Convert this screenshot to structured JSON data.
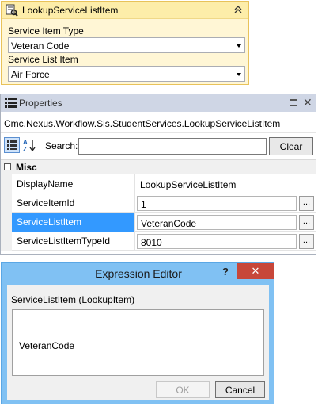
{
  "activity": {
    "title": "LookupServiceListItem",
    "icon": "lookup-activity-icon",
    "collapse_icon": "double-chevron-up-icon",
    "service_item_type_label": "Service Item Type",
    "service_item_type_value": "Veteran Code",
    "service_list_item_label": "Service List Item",
    "service_list_item_value": "Air Force",
    "colors": {
      "border": "#e8c25a",
      "background": "#fff6d5",
      "header": "#fdeda9"
    }
  },
  "properties": {
    "title": "Properties",
    "type_name": "Cmc.Nexus.Workflow.Sis.StudentServices.LookupServiceListItem",
    "search_label": "Search:",
    "search_value": "",
    "clear_label": "Clear",
    "category": "Misc",
    "rows": [
      {
        "name": "DisplayName",
        "value": "LookupServiceListItem"
      },
      {
        "name": "ServiceItemId",
        "value": "1"
      },
      {
        "name": "ServiceListItem",
        "value": "VeteranCode"
      },
      {
        "name": "ServiceListItemTypeId",
        "value": "8010"
      }
    ],
    "ellipsis": "...",
    "selected_row": "ServiceListItem",
    "colors": {
      "titlebar": "#cfd6e5",
      "selection": "#3399ff"
    }
  },
  "dialog": {
    "title": "Expression Editor",
    "help": "?",
    "close": "✕",
    "label": "ServiceListItem (LookupItem)",
    "expression": "VeteranCode",
    "ok_label": "OK",
    "cancel_label": "Cancel",
    "colors": {
      "frame": "#80c1f3",
      "close": "#c7473a"
    }
  }
}
